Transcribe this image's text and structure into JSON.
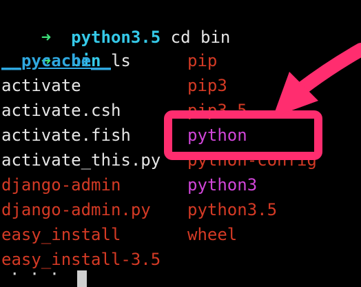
{
  "prompt": {
    "arrow_glyph": "➜",
    "lines": [
      {
        "dir": "python3.5",
        "command": "cd bin"
      },
      {
        "dir": "bin",
        "command": "ls"
      }
    ]
  },
  "listing": {
    "left": [
      {
        "name": "__pycache__",
        "kind": "pycache"
      },
      {
        "name": "activate",
        "kind": "plain"
      },
      {
        "name": "activate.csh",
        "kind": "plain"
      },
      {
        "name": "activate.fish",
        "kind": "plain"
      },
      {
        "name": "activate_this.py",
        "kind": "plain"
      },
      {
        "name": "django-admin",
        "kind": "red"
      },
      {
        "name": "django-admin.py",
        "kind": "red"
      },
      {
        "name": "easy_install",
        "kind": "red"
      },
      {
        "name": "easy_install-3.5",
        "kind": "red"
      }
    ],
    "right": [
      {
        "name": "pip",
        "kind": "red"
      },
      {
        "name": "pip3",
        "kind": "red"
      },
      {
        "name": "pip3.5",
        "kind": "red"
      },
      {
        "name": "python",
        "kind": "mag"
      },
      {
        "name": "python-config",
        "kind": "red"
      },
      {
        "name": "python3",
        "kind": "mag"
      },
      {
        "name": "python3.5",
        "kind": "red"
      },
      {
        "name": "wheel",
        "kind": "red"
      }
    ]
  },
  "annotation": {
    "color": "#ff2d6f",
    "highlighted_item": "python"
  }
}
